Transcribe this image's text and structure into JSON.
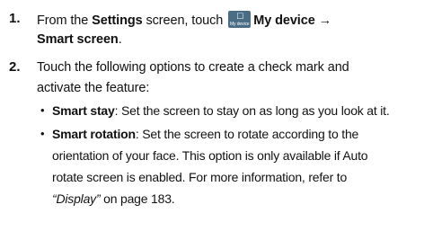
{
  "steps": [
    {
      "number": "1.",
      "part1": "From the ",
      "settings": "Settings",
      "part2": " screen, touch",
      "icon_caption": "My device",
      "icon_name": "my-device-icon",
      "my_device": "My device",
      "arrow": "→",
      "smart_screen": "Smart screen",
      "period": "."
    },
    {
      "number": "2.",
      "line1": "Touch the following options to create a check mark and",
      "line2": "activate the feature:"
    }
  ],
  "bullets": [
    {
      "title": "Smart stay",
      "line1_rest": ": Set the screen to stay on as long as you look at it."
    },
    {
      "title": "Smart rotation",
      "line1_rest": ": Set the screen to rotate according to the",
      "line2": "orientation of your face. This option is only available if Auto",
      "line3": "rotate screen is enabled. For more information, refer to",
      "ref": "“Display”",
      "ref_rest": " on page 183."
    }
  ]
}
